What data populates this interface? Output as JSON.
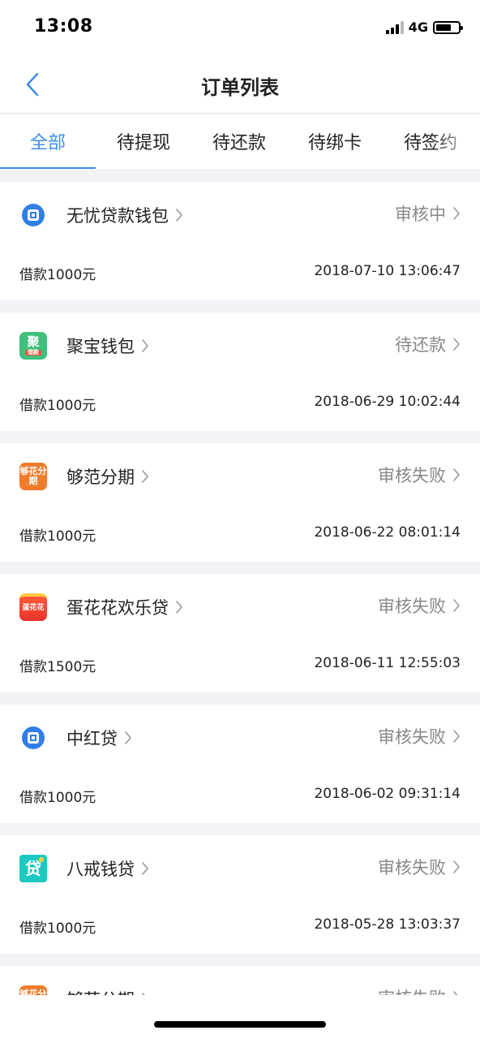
{
  "status_bar": {
    "time": "13:08",
    "network": "4G",
    "battery_level": 0.7
  },
  "nav": {
    "title": "订单列表"
  },
  "tabs": [
    {
      "label": "全部",
      "active": true
    },
    {
      "label": "待提现",
      "active": false
    },
    {
      "label": "待还款",
      "active": false
    },
    {
      "label": "待绑卡",
      "active": false
    },
    {
      "label": "待签约",
      "active": false
    }
  ],
  "orders": [
    {
      "logo_icon": "blue-circle-logo-icon",
      "logo_text": "",
      "name": "无忧贷款钱包",
      "status": "审核中",
      "amount": "借款1000元",
      "time": "2018-07-10 13:06:47"
    },
    {
      "logo_icon": "green-ju-logo-icon",
      "logo_text": "聚",
      "logo_subtext": "借款",
      "name": "聚宝钱包",
      "status": "待还款",
      "amount": "借款1000元",
      "time": "2018-06-29 10:02:44"
    },
    {
      "logo_icon": "orange-goufan-logo-icon",
      "logo_text": "够花分期",
      "name": "够范分期",
      "status": "审核失败",
      "amount": "借款1000元",
      "time": "2018-06-22 08:01:14"
    },
    {
      "logo_icon": "red-danhuahua-logo-icon",
      "logo_text": "蛋花花",
      "name": "蛋花花欢乐贷",
      "status": "审核失败",
      "amount": "借款1500元",
      "time": "2018-06-11 12:55:03"
    },
    {
      "logo_icon": "blue-circle-logo-icon",
      "logo_text": "",
      "name": "中红贷",
      "status": "审核失败",
      "amount": "借款1000元",
      "time": "2018-06-02 09:31:14"
    },
    {
      "logo_icon": "teal-dai-logo-icon",
      "logo_text": "贷",
      "name": "八戒钱贷",
      "status": "审核失败",
      "amount": "借款1000元",
      "time": "2018-05-28 13:03:37"
    },
    {
      "logo_icon": "orange-goufan-logo-icon",
      "logo_text": "够花分期",
      "name": "够范分期",
      "status": "审核失败",
      "amount": "",
      "time": ""
    }
  ],
  "colors": {
    "accent": "#3b8de8",
    "background": "#f2f3f7",
    "status_text": "#888888"
  }
}
